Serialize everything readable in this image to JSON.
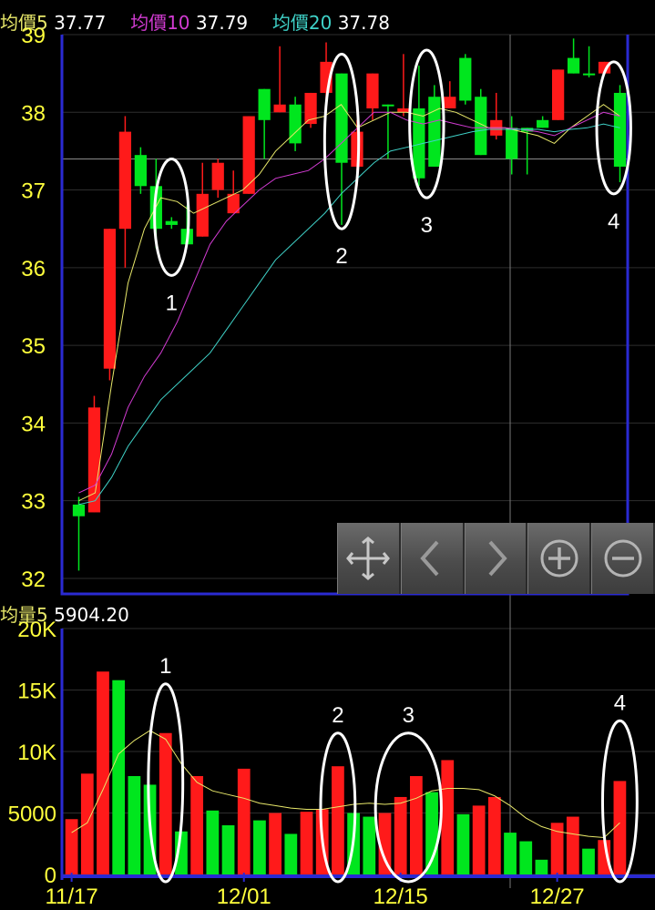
{
  "price_legend": {
    "ma5_label": "均價5",
    "ma5_value": "37.77",
    "ma10_label": "均價10",
    "ma10_value": "37.79",
    "ma20_label": "均價20",
    "ma20_value": "37.78"
  },
  "volume_legend": {
    "label": "均量5",
    "value": "5904.20"
  },
  "toolbar": [
    {
      "name": "crosshair-icon"
    },
    {
      "name": "chevron-left-icon"
    },
    {
      "name": "chevron-right-icon"
    },
    {
      "name": "zoom-in-icon"
    },
    {
      "name": "zoom-out-icon"
    }
  ],
  "colors": {
    "up": "#ff1a1a",
    "down": "#00e61e",
    "ma5": "#e8e86a",
    "ma10": "#d23bd2",
    "ma20": "#3fd2c8",
    "axis_text": "#ffff3c",
    "frame": "#2a2ad2",
    "annotation": "#ffffff"
  },
  "chart_data": [
    {
      "type": "candlestick",
      "ylim": [
        31.8,
        39.0
      ],
      "yticks": [
        32,
        33,
        34,
        35,
        36,
        37,
        38,
        39
      ],
      "series": [
        {
          "name": "均價5",
          "values": [
            33.0,
            33.1,
            34.5,
            35.8,
            36.5,
            36.9,
            36.85,
            36.7,
            36.8,
            36.9,
            37.0,
            37.2,
            37.5,
            37.7,
            37.9,
            37.95,
            38.1,
            37.8,
            37.9,
            38.0,
            38.0,
            37.95,
            38.05,
            38.0,
            37.9,
            37.8,
            37.8,
            37.75,
            37.7,
            37.6,
            37.8,
            37.95,
            38.1,
            37.95
          ]
        },
        {
          "name": "均價10",
          "values": [
            33.1,
            33.2,
            33.6,
            34.2,
            34.6,
            34.9,
            35.3,
            35.8,
            36.3,
            36.6,
            36.8,
            37.0,
            37.15,
            37.2,
            37.25,
            37.4,
            37.6,
            37.8,
            38.0,
            38.0,
            37.9,
            37.85,
            37.9,
            37.85,
            37.8,
            37.8,
            37.8,
            37.78,
            37.75,
            37.7,
            37.8,
            37.9,
            38.0,
            37.95
          ]
        },
        {
          "name": "均價20",
          "values": [
            32.95,
            33.0,
            33.3,
            33.7,
            34.0,
            34.3,
            34.5,
            34.7,
            34.9,
            35.2,
            35.5,
            35.8,
            36.1,
            36.3,
            36.5,
            36.7,
            36.95,
            37.15,
            37.35,
            37.5,
            37.55,
            37.6,
            37.65,
            37.7,
            37.75,
            37.78,
            37.78,
            37.78,
            37.78,
            37.75,
            37.78,
            37.8,
            37.85,
            37.8
          ]
        }
      ],
      "candles": [
        {
          "o": 32.8,
          "c": 32.95,
          "h": 33.05,
          "l": 32.1,
          "up": false
        },
        {
          "o": 32.85,
          "c": 34.2,
          "h": 34.35,
          "l": 32.85,
          "up": true
        },
        {
          "o": 34.7,
          "c": 36.5,
          "h": 36.5,
          "l": 34.55,
          "up": true
        },
        {
          "o": 36.5,
          "c": 37.75,
          "h": 37.95,
          "l": 36.0,
          "up": true
        },
        {
          "o": 37.45,
          "c": 37.05,
          "h": 37.55,
          "l": 36.95,
          "up": false
        },
        {
          "o": 37.05,
          "c": 36.5,
          "h": 37.4,
          "l": 36.25,
          "up": false
        },
        {
          "o": 36.6,
          "c": 36.55,
          "h": 36.65,
          "l": 36.5,
          "up": false
        },
        {
          "o": 36.5,
          "c": 36.3,
          "h": 36.8,
          "l": 36.3,
          "up": false
        },
        {
          "o": 36.4,
          "c": 36.95,
          "h": 37.35,
          "l": 36.4,
          "up": true
        },
        {
          "o": 37.0,
          "c": 37.35,
          "h": 37.4,
          "l": 36.9,
          "up": true
        },
        {
          "o": 36.7,
          "c": 36.95,
          "h": 37.25,
          "l": 36.7,
          "up": true
        },
        {
          "o": 36.95,
          "c": 37.95,
          "h": 37.95,
          "l": 36.95,
          "up": true
        },
        {
          "o": 38.3,
          "c": 37.9,
          "h": 38.3,
          "l": 37.4,
          "up": false
        },
        {
          "o": 38.0,
          "c": 38.1,
          "h": 38.85,
          "l": 38.0,
          "up": true
        },
        {
          "o": 38.1,
          "c": 37.6,
          "h": 38.2,
          "l": 37.5,
          "up": false
        },
        {
          "o": 37.85,
          "c": 38.25,
          "h": 38.25,
          "l": 37.8,
          "up": true
        },
        {
          "o": 38.25,
          "c": 38.65,
          "h": 38.9,
          "l": 38.1,
          "up": true
        },
        {
          "o": 38.5,
          "c": 37.35,
          "h": 38.5,
          "l": 36.55,
          "up": false
        },
        {
          "o": 37.3,
          "c": 37.75,
          "h": 37.9,
          "l": 37.05,
          "up": true
        },
        {
          "o": 38.05,
          "c": 38.5,
          "h": 38.5,
          "l": 37.9,
          "up": true
        },
        {
          "o": 38.1,
          "c": 38.1,
          "h": 38.1,
          "l": 37.4,
          "up": false
        },
        {
          "o": 38.0,
          "c": 38.05,
          "h": 38.75,
          "l": 37.95,
          "up": true
        },
        {
          "o": 38.05,
          "c": 37.15,
          "h": 38.6,
          "l": 37.05,
          "up": false
        },
        {
          "o": 38.2,
          "c": 37.3,
          "h": 38.35,
          "l": 37.3,
          "up": false
        },
        {
          "o": 38.05,
          "c": 38.2,
          "h": 38.4,
          "l": 38.05,
          "up": true
        },
        {
          "o": 38.7,
          "c": 38.15,
          "h": 38.75,
          "l": 38.1,
          "up": false
        },
        {
          "o": 38.2,
          "c": 37.45,
          "h": 38.3,
          "l": 37.45,
          "up": false
        },
        {
          "o": 37.7,
          "c": 37.9,
          "h": 38.25,
          "l": 37.65,
          "up": true
        },
        {
          "o": 37.8,
          "c": 37.4,
          "h": 37.95,
          "l": 37.2,
          "up": false
        },
        {
          "o": 37.8,
          "c": 37.75,
          "h": 37.8,
          "l": 37.2,
          "up": false
        },
        {
          "o": 37.9,
          "c": 37.8,
          "h": 37.95,
          "l": 37.8,
          "up": false
        },
        {
          "o": 37.9,
          "c": 38.55,
          "h": 38.55,
          "l": 37.9,
          "up": true
        },
        {
          "o": 38.7,
          "c": 38.5,
          "h": 38.95,
          "l": 38.5,
          "up": false
        },
        {
          "o": 38.5,
          "c": 38.5,
          "h": 38.85,
          "l": 38.45,
          "up": false
        },
        {
          "o": 38.5,
          "c": 38.65,
          "h": 38.65,
          "l": 38.5,
          "up": true
        },
        {
          "o": 38.25,
          "c": 37.3,
          "h": 38.35,
          "l": 37.1,
          "up": false
        }
      ],
      "annotations": [
        "1",
        "2",
        "3",
        "4"
      ]
    },
    {
      "type": "bar",
      "ylim": [
        0,
        20000
      ],
      "yticks": [
        "0",
        "5000",
        "10K",
        "15K",
        "20K"
      ],
      "xtick_labels": [
        "11/17",
        "12/01",
        "12/15",
        "12/27"
      ],
      "series": [
        {
          "name": "均量5",
          "values": [
            3400,
            4200,
            6900,
            9800,
            10900,
            11700,
            11000,
            9000,
            7500,
            6800,
            6500,
            6200,
            5800,
            5600,
            5400,
            5300,
            5300,
            5500,
            5700,
            5800,
            5700,
            5800,
            6200,
            6800,
            7000,
            7000,
            6900,
            6400,
            5600,
            4600,
            3900,
            3500,
            3300,
            3100,
            3000,
            4200
          ]
        }
      ],
      "values": [
        4500,
        8200,
        16500,
        15800,
        8000,
        7300,
        11500,
        3500,
        8000,
        5200,
        4000,
        8600,
        4400,
        5000,
        3300,
        5100,
        5300,
        8800,
        5000,
        4700,
        5000,
        6300,
        8000,
        6700,
        9300,
        4900,
        5600,
        6300,
        3400,
        2700,
        1200,
        4200,
        4700,
        2100,
        2800,
        7600
      ],
      "up": [
        true,
        true,
        true,
        false,
        false,
        false,
        true,
        false,
        true,
        false,
        false,
        true,
        false,
        true,
        false,
        true,
        true,
        true,
        false,
        false,
        true,
        true,
        true,
        false,
        true,
        false,
        true,
        true,
        false,
        false,
        false,
        true,
        true,
        false,
        true,
        true
      ],
      "annotations": [
        "1",
        "2",
        "3",
        "4"
      ]
    }
  ]
}
